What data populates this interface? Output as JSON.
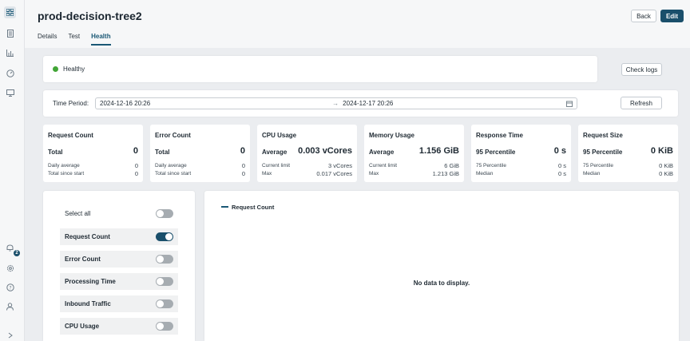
{
  "header": {
    "title": "prod-decision-tree2",
    "back_label": "Back",
    "edit_label": "Edit"
  },
  "tabs": [
    {
      "label": "Details",
      "active": false
    },
    {
      "label": "Test",
      "active": false
    },
    {
      "label": "Health",
      "active": true
    }
  ],
  "status": {
    "label": "Healthy",
    "color": "#41a536",
    "check_logs_label": "Check logs"
  },
  "time_period": {
    "label": "Time Period:",
    "start": "2024-12-16 20:26",
    "arrow": "→",
    "end": "2024-12-17 20:26",
    "refresh_label": "Refresh"
  },
  "metrics": [
    {
      "title": "Request Count",
      "main_label": "Total",
      "main_value": "0",
      "rows": [
        {
          "label": "Daily average",
          "value": "0"
        },
        {
          "label": "Total since start",
          "value": "0"
        }
      ]
    },
    {
      "title": "Error Count",
      "main_label": "Total",
      "main_value": "0",
      "rows": [
        {
          "label": "Daily average",
          "value": "0"
        },
        {
          "label": "Total since start",
          "value": "0"
        }
      ]
    },
    {
      "title": "CPU Usage",
      "main_label": "Average",
      "main_value": "0.003 vCores",
      "rows": [
        {
          "label": "Current limit",
          "value": "3 vCores"
        },
        {
          "label": "Max",
          "value": "0.017 vCores"
        }
      ]
    },
    {
      "title": "Memory Usage",
      "main_label": "Average",
      "main_value": "1.156 GiB",
      "rows": [
        {
          "label": "Current limit",
          "value": "6 GiB"
        },
        {
          "label": "Max",
          "value": "1.213 GiB"
        }
      ]
    },
    {
      "title": "Response Time",
      "main_label": "95 Percentile",
      "main_value": "0 s",
      "rows": [
        {
          "label": "75 Percentile",
          "value": "0 s"
        },
        {
          "label": "Median",
          "value": "0 s"
        }
      ]
    },
    {
      "title": "Request Size",
      "main_label": "95 Percentile",
      "main_value": "0 KiB",
      "rows": [
        {
          "label": "75 Percentile",
          "value": "0 KiB"
        },
        {
          "label": "Median",
          "value": "0 KiB"
        }
      ]
    }
  ],
  "toggles": {
    "select_all": {
      "label": "Select all",
      "on": false
    },
    "items": [
      {
        "label": "Request Count",
        "on": true
      },
      {
        "label": "Error Count",
        "on": false
      },
      {
        "label": "Processing Time",
        "on": false
      },
      {
        "label": "Inbound Traffic",
        "on": false
      },
      {
        "label": "CPU Usage",
        "on": false
      }
    ]
  },
  "chart": {
    "legend_label": "Request Count",
    "empty_message": "No data to display.",
    "legend_color": "#1a5875"
  },
  "sidebar": {
    "icons": [
      "dashboard-icon",
      "document-icon",
      "bar-chart-icon",
      "gauge-icon",
      "monitor-icon",
      "notifications-icon",
      "settings-icon",
      "help-icon",
      "user-icon",
      "chevron-right-icon"
    ],
    "notification_count": "2"
  },
  "colors": {
    "primary": "#1a4f6b",
    "healthy": "#41a536",
    "background": "#ebedf0"
  }
}
